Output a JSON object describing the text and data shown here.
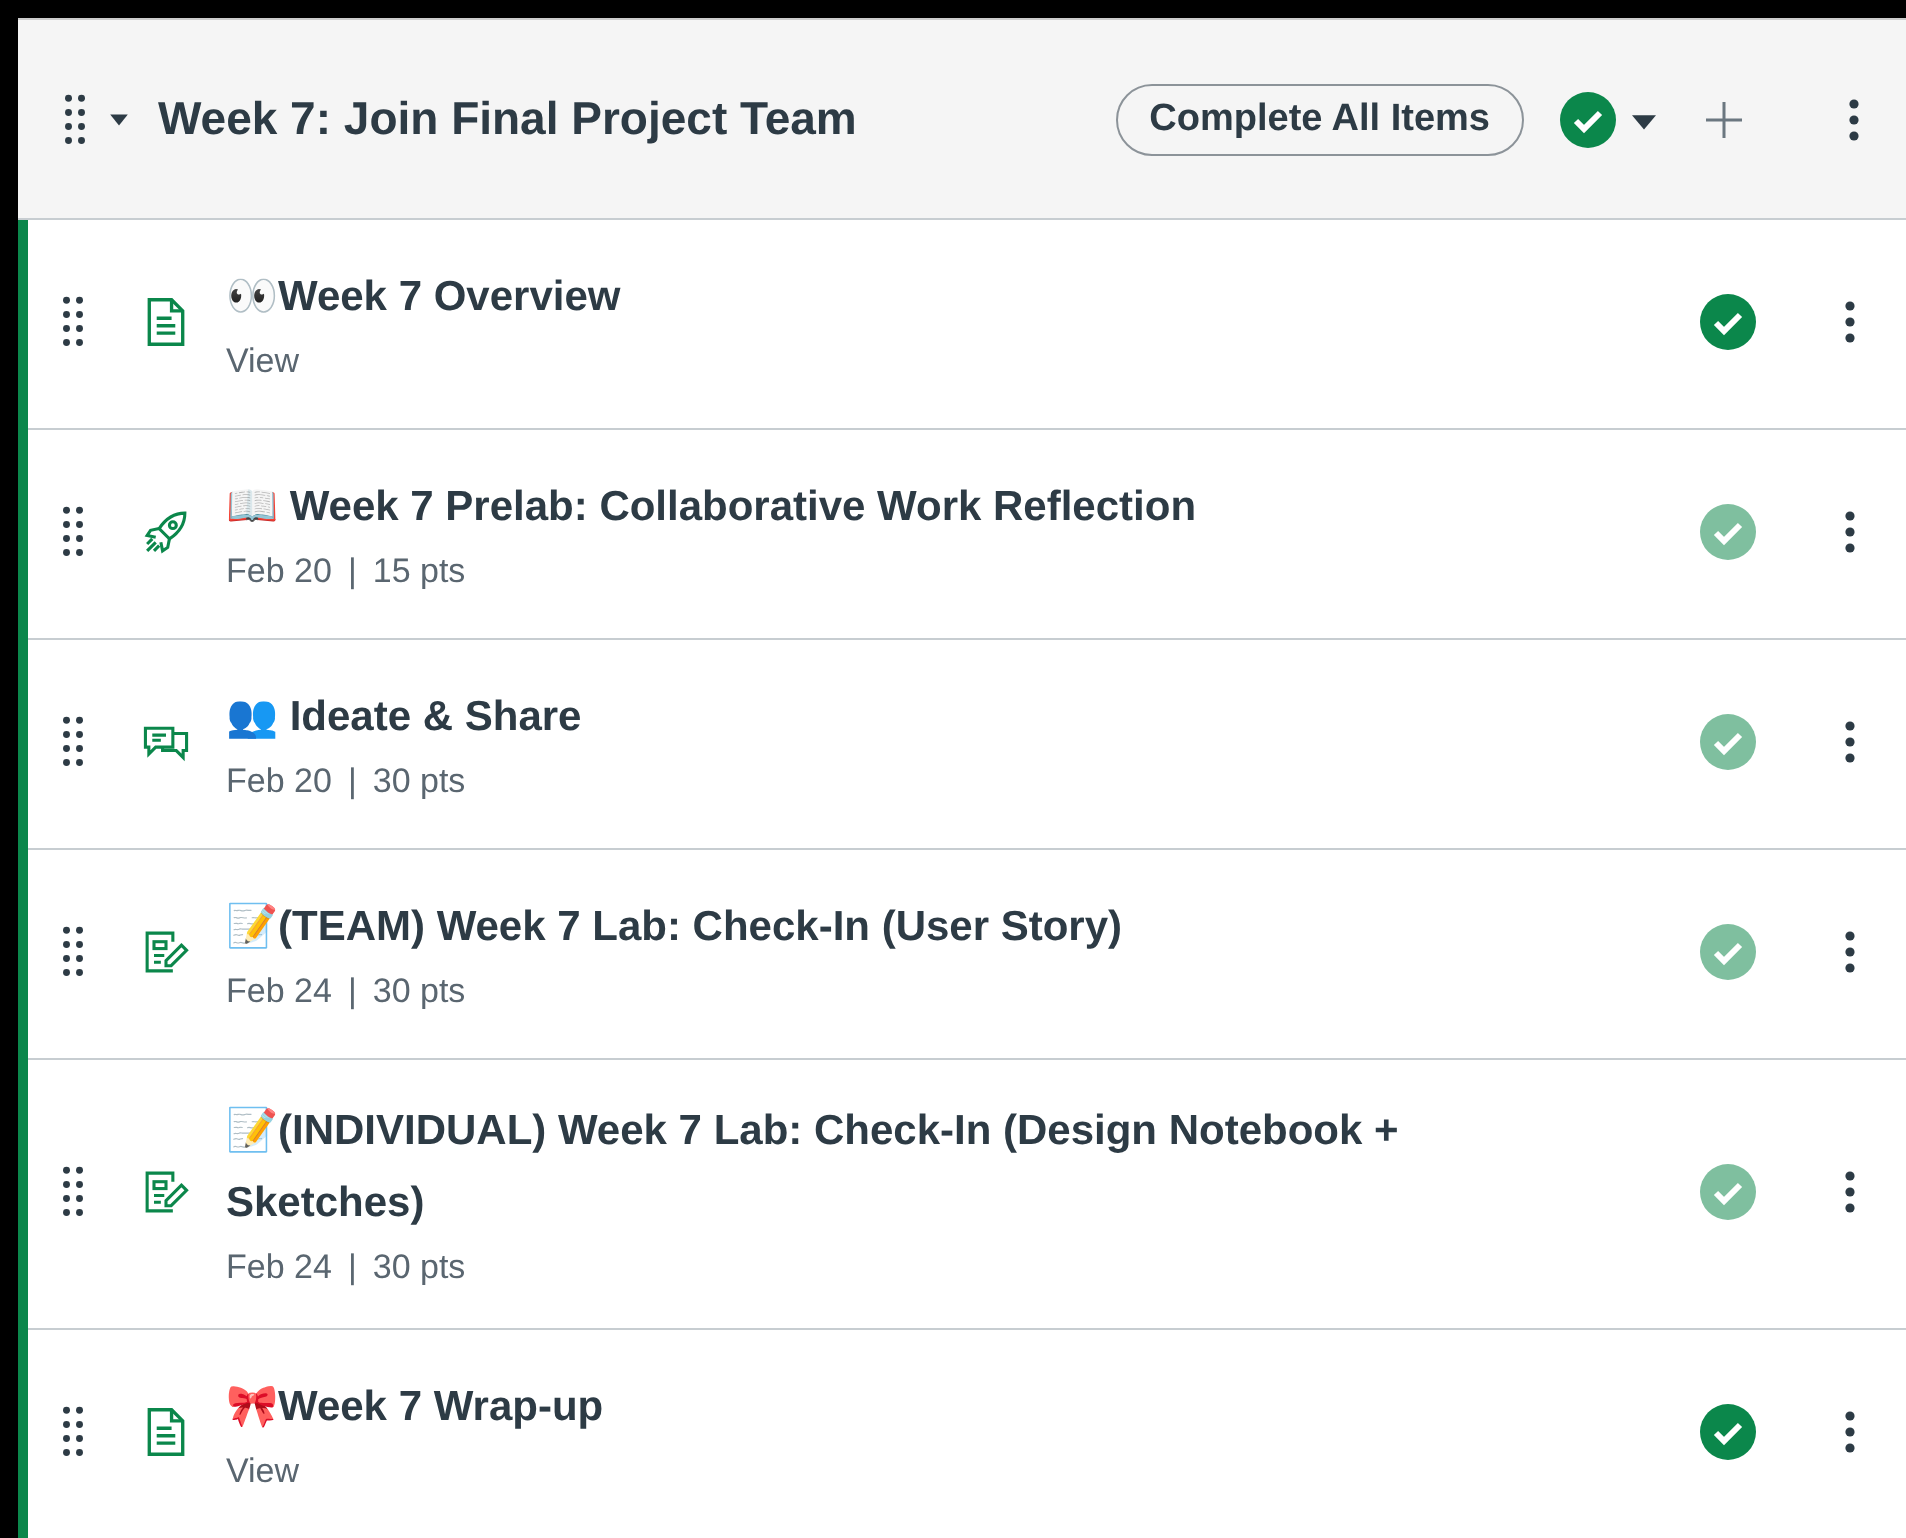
{
  "module": {
    "title": "Week 7: Join Final Project Team",
    "expanded": true,
    "complete_button": "Complete All Items",
    "published": true
  },
  "items": [
    {
      "kind": "page",
      "title": "👀Week 7 Overview",
      "meta": [
        "View"
      ],
      "published": true,
      "locked": false
    },
    {
      "kind": "quiz",
      "title": "📖 Week 7 Prelab: Collaborative Work Reflection",
      "meta": [
        "Feb 20",
        "|",
        "15 pts"
      ],
      "published": true,
      "locked": true
    },
    {
      "kind": "discussion",
      "title": "👥 Ideate & Share",
      "meta": [
        "Feb 20",
        "|",
        "30 pts"
      ],
      "published": true,
      "locked": true
    },
    {
      "kind": "assignment",
      "title": "📝(TEAM) Week 7 Lab: Check-In (User Story)",
      "meta": [
        "Feb 24",
        "|",
        "30 pts"
      ],
      "published": true,
      "locked": true
    },
    {
      "kind": "assignment",
      "title": "📝(INDIVIDUAL) Week 7 Lab: Check-In (Design Notebook + Sketches)",
      "meta": [
        "Feb 24",
        "|",
        "30 pts"
      ],
      "published": true,
      "locked": true
    },
    {
      "kind": "page",
      "title": "🎀Week 7 Wrap-up",
      "meta": [
        "View"
      ],
      "published": true,
      "locked": false
    }
  ]
}
